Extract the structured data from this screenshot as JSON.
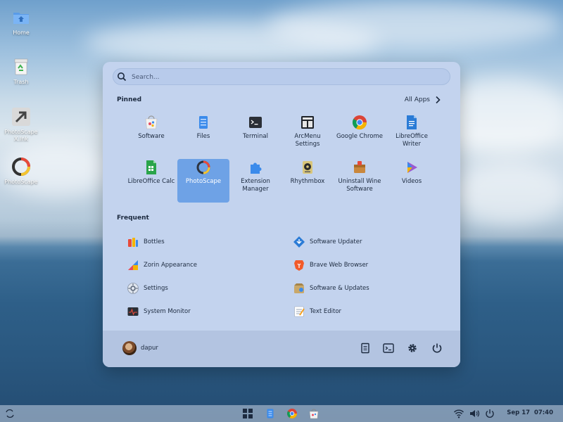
{
  "desktop": {
    "icons": [
      {
        "label": "Home",
        "icon": "home-folder-icon"
      },
      {
        "label": "Trash",
        "icon": "trash-icon"
      },
      {
        "label": "PhotoScape X.lnk",
        "icon": "shortcut-icon"
      },
      {
        "label": "PhotoScape",
        "icon": "photoscape-icon"
      }
    ]
  },
  "menu": {
    "search_placeholder": "Search...",
    "pinned_title": "Pinned",
    "all_apps_label": "All Apps",
    "pinned": [
      {
        "label": "Software",
        "icon": "software-icon"
      },
      {
        "label": "Files",
        "icon": "files-icon"
      },
      {
        "label": "Terminal",
        "icon": "terminal-icon"
      },
      {
        "label": "ArcMenu Settings",
        "icon": "arcmenu-settings-icon"
      },
      {
        "label": "Google Chrome",
        "icon": "chrome-icon"
      },
      {
        "label": "LibreOffice Writer",
        "icon": "writer-icon"
      },
      {
        "label": "LibreOffice Calc",
        "icon": "calc-icon"
      },
      {
        "label": "PhotoScape",
        "icon": "photoscape-icon",
        "active": true
      },
      {
        "label": "Extension Manager",
        "icon": "extension-icon"
      },
      {
        "label": "Rhythmbox",
        "icon": "rhythmbox-icon"
      },
      {
        "label": "Uninstall Wine Software",
        "icon": "wine-icon"
      },
      {
        "label": "Videos",
        "icon": "videos-icon"
      }
    ],
    "frequent_title": "Frequent",
    "frequent": [
      {
        "label": "Bottles",
        "icon": "bottles-icon"
      },
      {
        "label": "Software Updater",
        "icon": "updater-icon"
      },
      {
        "label": "Zorin Appearance",
        "icon": "appearance-icon"
      },
      {
        "label": "Brave Web Browser",
        "icon": "brave-icon"
      },
      {
        "label": "Settings",
        "icon": "settings-icon"
      },
      {
        "label": "Software & Updates",
        "icon": "software-updates-icon"
      },
      {
        "label": "System Monitor",
        "icon": "system-monitor-icon"
      },
      {
        "label": "Text Editor",
        "icon": "text-editor-icon"
      }
    ],
    "user": {
      "name": "dapur"
    }
  },
  "taskbar": {
    "clock": "Sep 17  07:40"
  },
  "colors": {
    "menu_bg": "#c3d3ee",
    "active_tile": "#6ea2e6",
    "footer_bg": "#b3c4e1"
  }
}
